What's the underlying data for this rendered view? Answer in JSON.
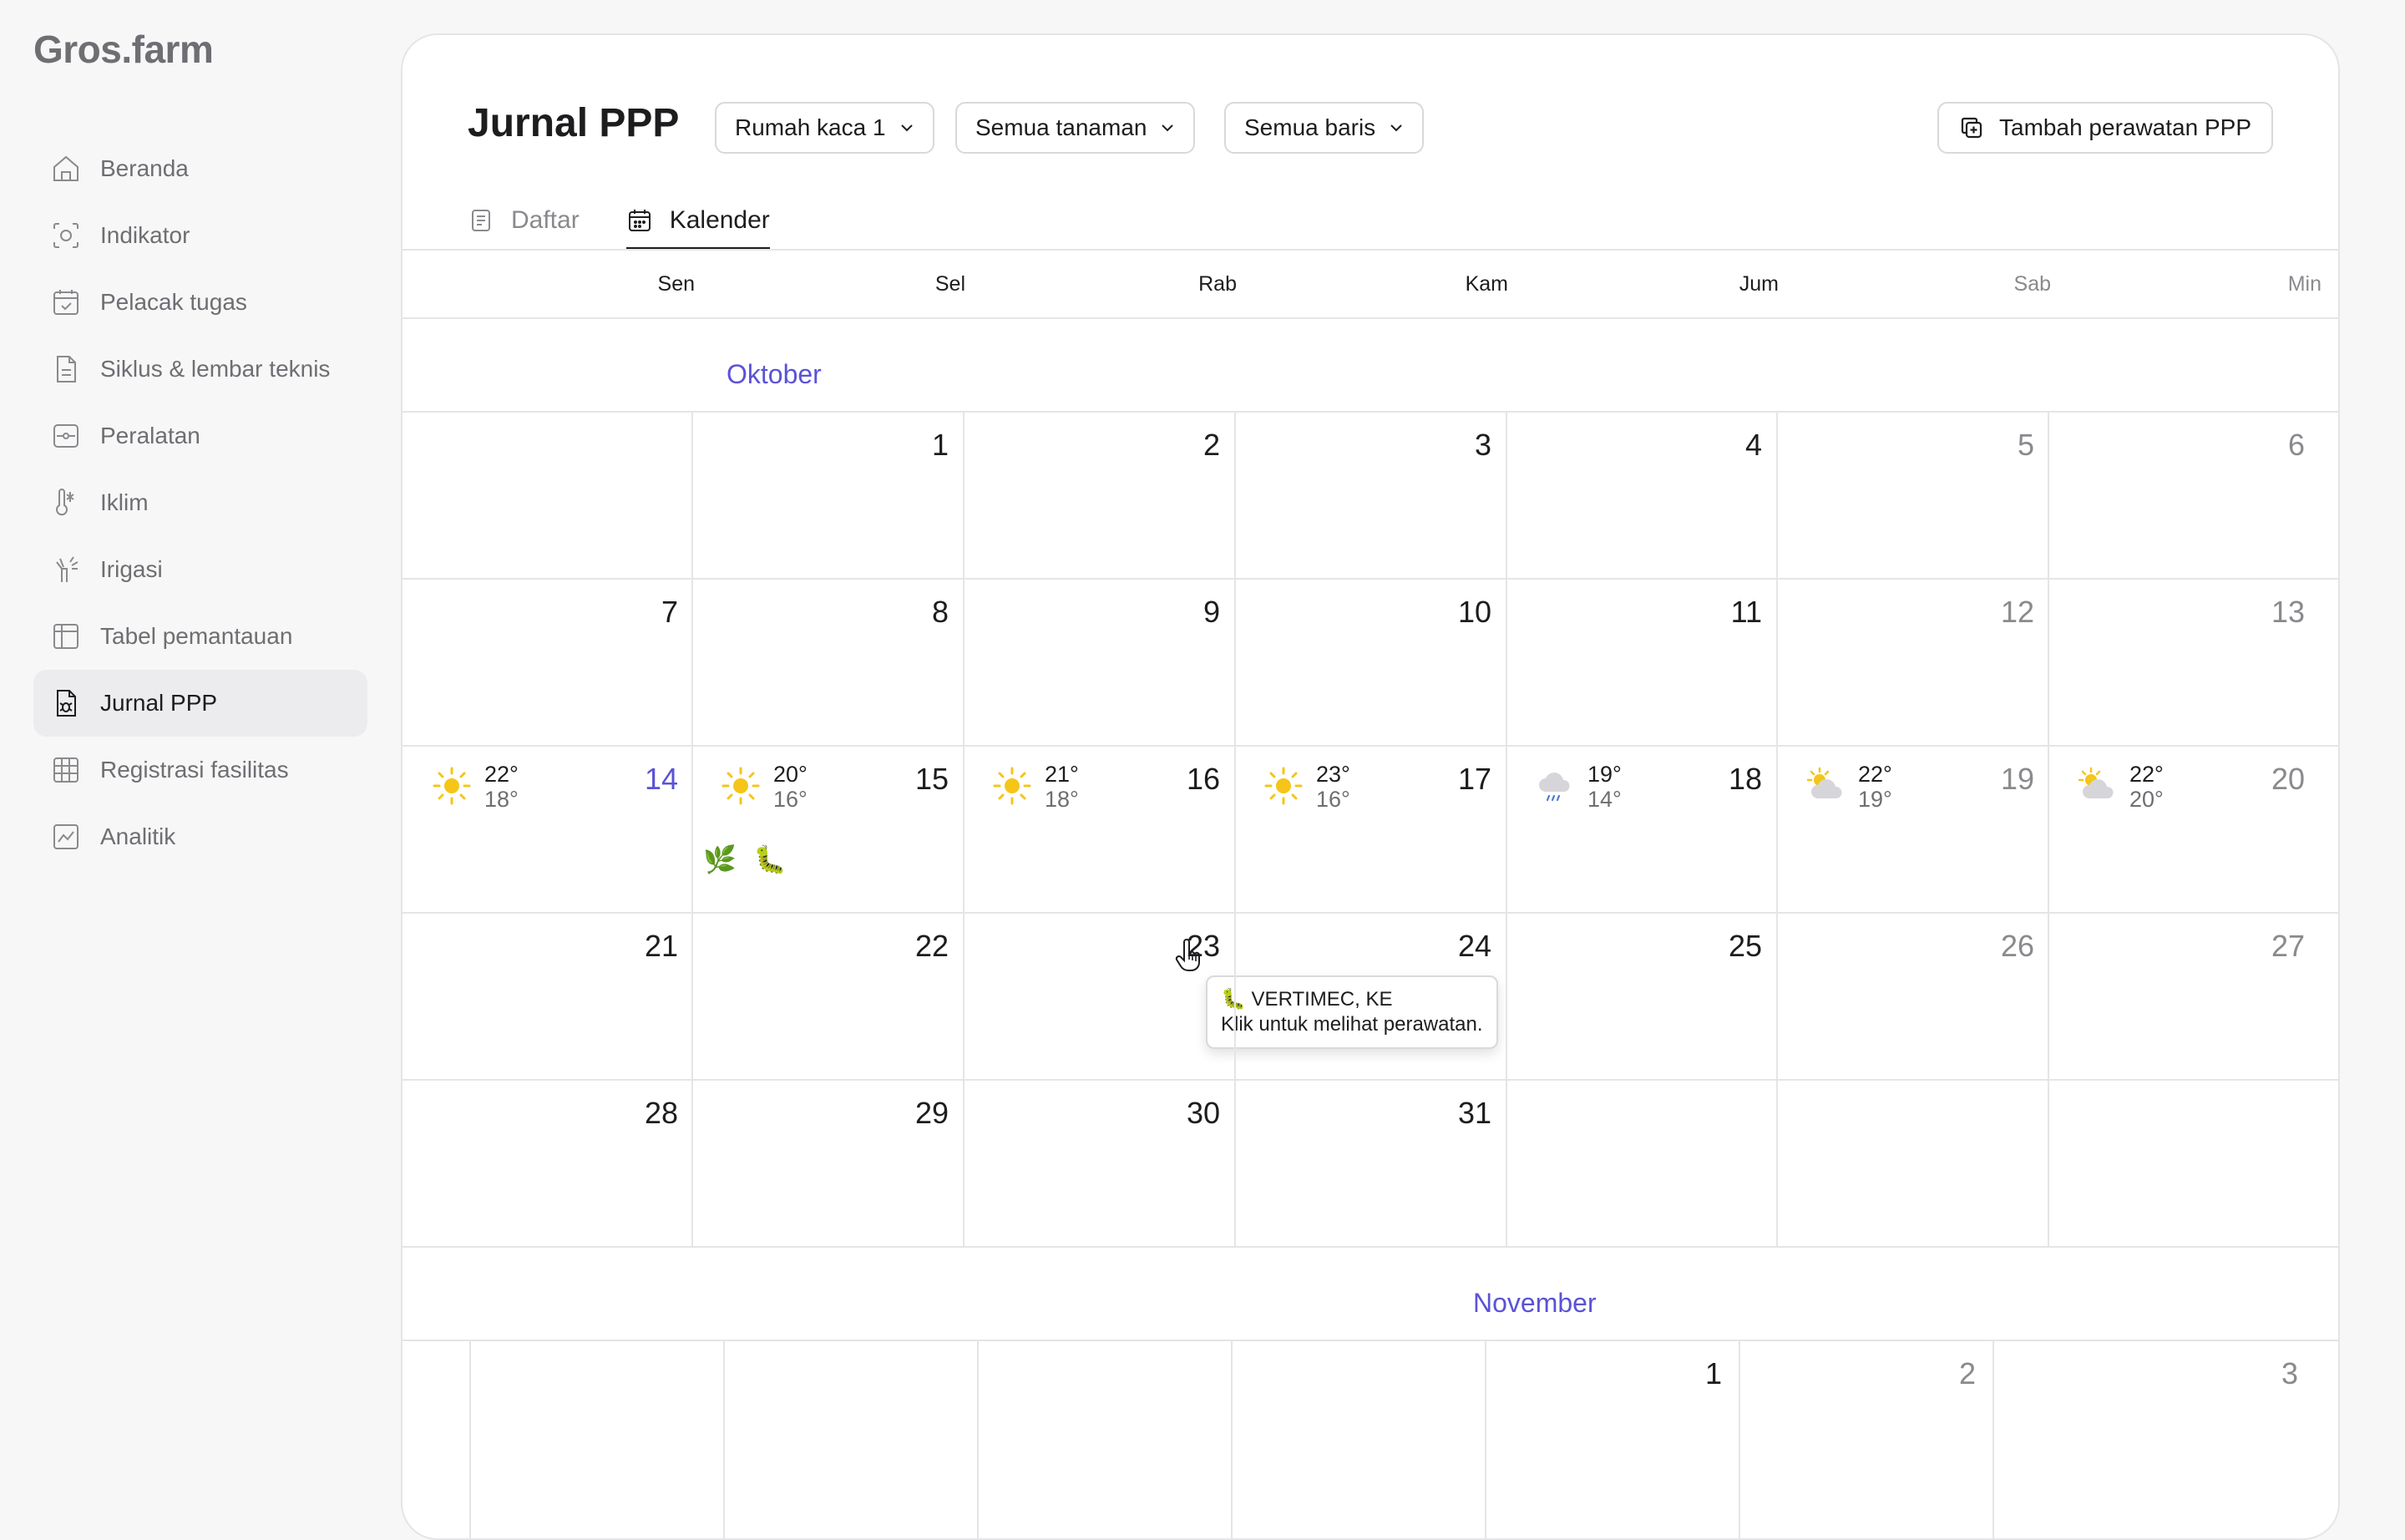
{
  "app": {
    "logo": "Gros.farm"
  },
  "sidebar": {
    "items": [
      {
        "label": "Beranda",
        "icon": "home-icon"
      },
      {
        "label": "Indikator",
        "icon": "target-icon"
      },
      {
        "label": "Pelacak tugas",
        "icon": "calendar-check-icon"
      },
      {
        "label": "Siklus & lembar teknis",
        "icon": "document-icon"
      },
      {
        "label": "Peralatan",
        "icon": "device-icon"
      },
      {
        "label": "Iklim",
        "icon": "thermometer-icon"
      },
      {
        "label": "Irigasi",
        "icon": "sprinkler-icon"
      },
      {
        "label": "Tabel pemantauan",
        "icon": "table-icon"
      },
      {
        "label": "Jurnal PPP",
        "icon": "bug-document-icon",
        "active": true
      },
      {
        "label": "Registrasi fasilitas",
        "icon": "grid-icon"
      },
      {
        "label": "Analitik",
        "icon": "chart-icon"
      }
    ]
  },
  "header": {
    "title": "Jurnal PPP",
    "filters": [
      "Rumah kaca 1",
      "Semua tanaman",
      "Semua baris"
    ],
    "add_button": "Tambah perawatan PPP"
  },
  "tabs": [
    {
      "label": "Daftar",
      "active": false
    },
    {
      "label": "Kalender",
      "active": true
    }
  ],
  "weekdays": [
    "Sen",
    "Sel",
    "Rab",
    "Kam",
    "Jum",
    "Sab",
    "Min"
  ],
  "october": {
    "label": "Oktober",
    "weeks": [
      [
        "",
        "1",
        "2",
        "3",
        "4",
        "5",
        "6"
      ],
      [
        "7",
        "8",
        "9",
        "10",
        "11",
        "12",
        "13"
      ],
      [
        "14",
        "15",
        "16",
        "17",
        "18",
        "19",
        "20"
      ],
      [
        "21",
        "22",
        "23",
        "24",
        "25",
        "26",
        "27"
      ],
      [
        "28",
        "29",
        "30",
        "31",
        "",
        "",
        ""
      ]
    ],
    "today": "14",
    "weather": [
      {
        "day": "14",
        "icon": "sun-icon",
        "hi": "22°",
        "lo": "18°"
      },
      {
        "day": "15",
        "icon": "sun-icon",
        "hi": "20°",
        "lo": "16°"
      },
      {
        "day": "16",
        "icon": "sun-icon",
        "hi": "21°",
        "lo": "18°"
      },
      {
        "day": "17",
        "icon": "sun-icon",
        "hi": "23°",
        "lo": "16°"
      },
      {
        "day": "18",
        "icon": "rain-cloud-icon",
        "hi": "19°",
        "lo": "14°"
      },
      {
        "day": "19",
        "icon": "partly-cloudy-icon",
        "hi": "22°",
        "lo": "19°"
      },
      {
        "day": "20",
        "icon": "partly-cloudy-icon",
        "hi": "22°",
        "lo": "20°"
      }
    ],
    "treatments_day15": [
      "🌿",
      "🐛"
    ]
  },
  "tooltip": {
    "title": "🐛 VERTIMEC, KE",
    "subtitle": "Klik untuk melihat perawatan."
  },
  "november": {
    "label": "November",
    "days": [
      "",
      "",
      "",
      "",
      "1",
      "2",
      "3"
    ]
  },
  "colors": {
    "accent": "#5b52d6",
    "sun": "#f5c518",
    "border": "#e5e5e7"
  }
}
